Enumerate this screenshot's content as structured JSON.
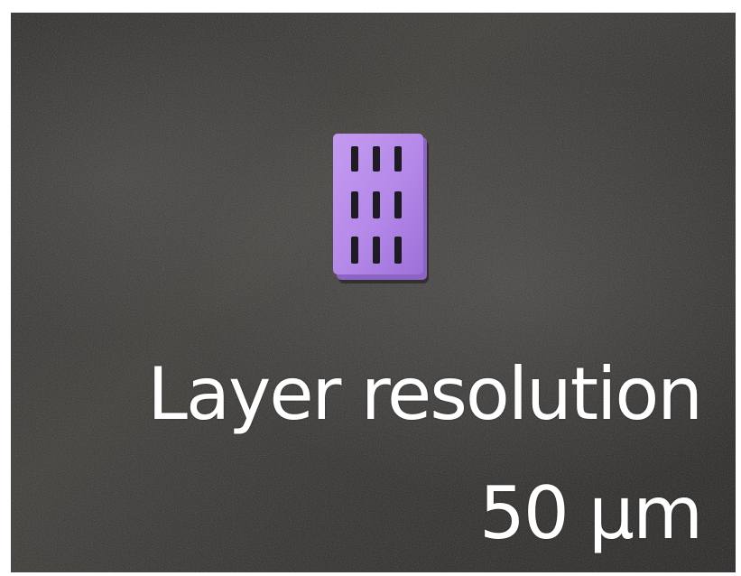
{
  "image": {
    "background_color": "#2f2d2b",
    "specimen_color": "#b488e8",
    "specimen_shadow_color": "#8d63c4",
    "hole_color": "#1f1b24",
    "text_color": "#ffffff"
  },
  "caption": {
    "line_1": "Layer resolution",
    "line_2": "50 µm"
  }
}
